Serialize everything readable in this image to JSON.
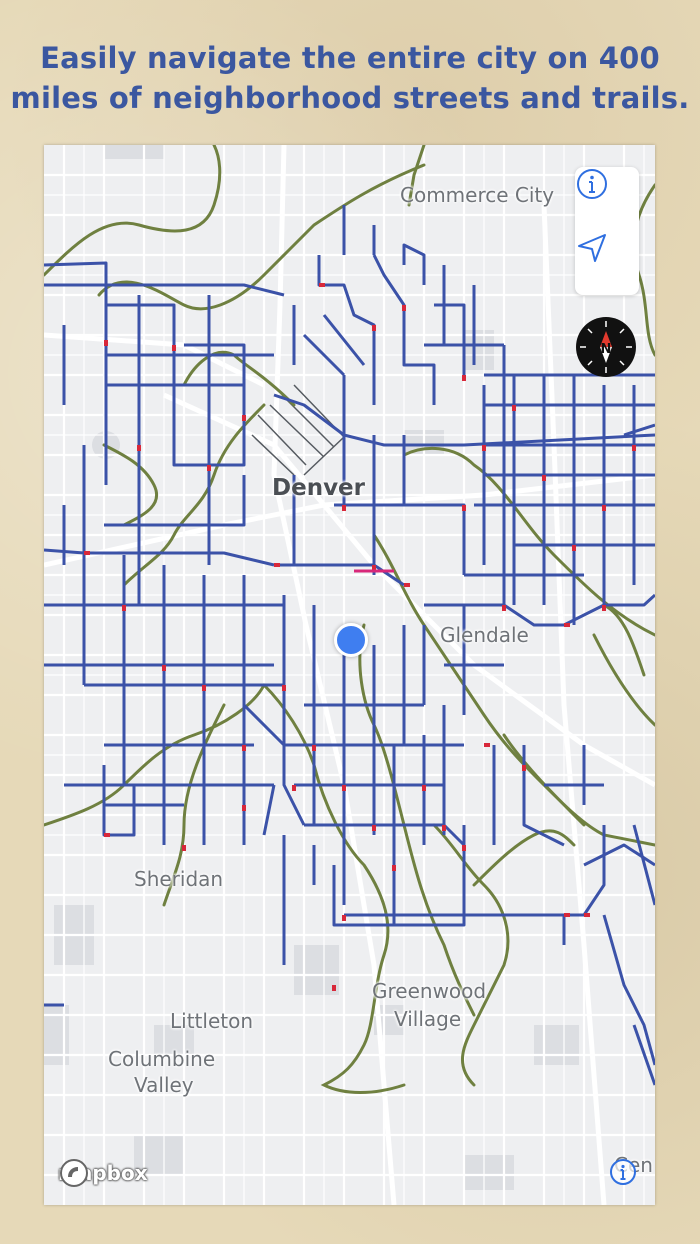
{
  "headline": {
    "line1": "Easily navigate the entire city on 400",
    "line2": "miles of neighborhood streets and trails."
  },
  "map": {
    "labels": {
      "commerce_city": "Commerce City",
      "denver": "Denver",
      "glendale": "Glendale",
      "sheridan": "Sheridan",
      "littleton": "Littleton",
      "columbine": "Columbine",
      "valley": "Valley",
      "greenwood": "Greenwood",
      "village": "Village",
      "cen": "Cen"
    },
    "attribution_logo": "mapbox",
    "controls": {
      "info_icon": "info-icon",
      "locate_icon": "location-arrow-icon",
      "compass_letter": "N"
    },
    "colors": {
      "route": "#3b52a8",
      "route_break": "#d8283a",
      "trail": "#6f8040",
      "street": "#ffffff",
      "park": "#d9dbdf",
      "headline": "#3b57a0",
      "user_location": "#3f7ef0"
    }
  }
}
